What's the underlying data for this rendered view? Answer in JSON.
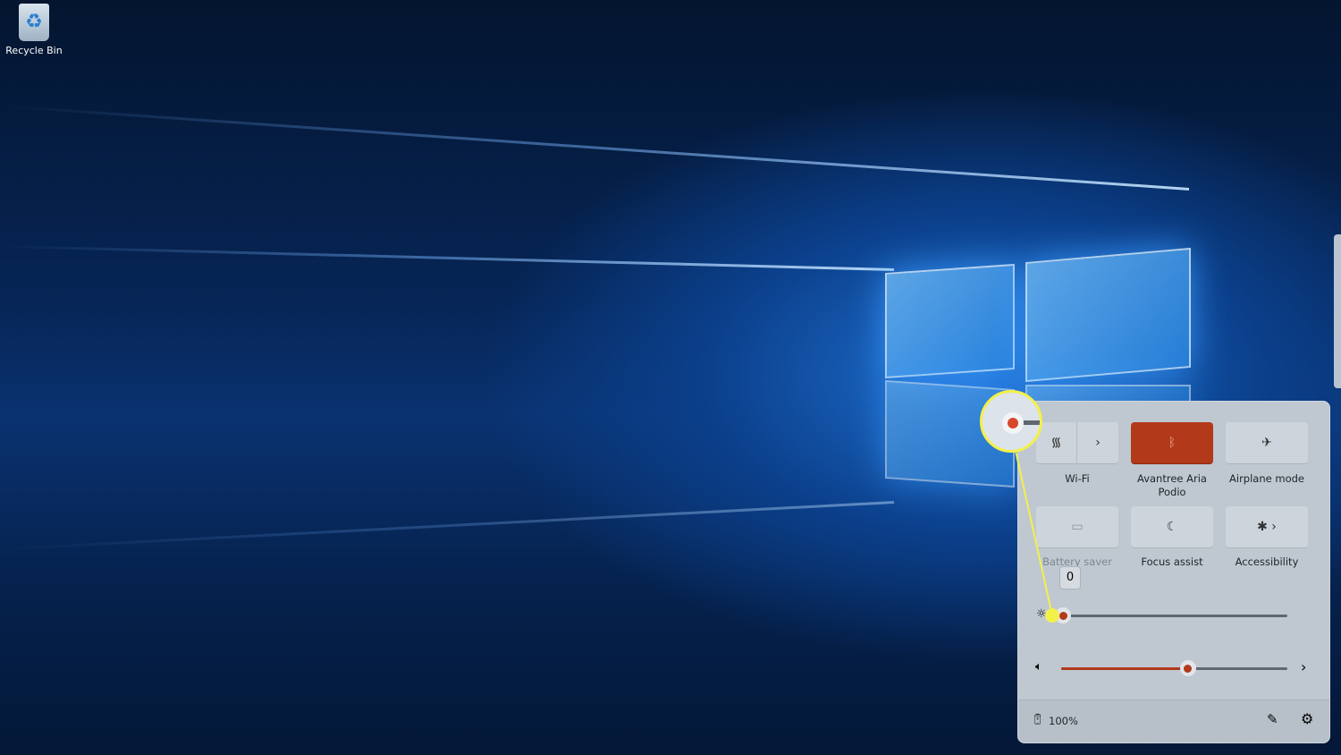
{
  "desktop": {
    "icons": [
      {
        "label": "Recycle Bin",
        "icon": "recycle-bin-icon"
      }
    ]
  },
  "quick_settings": {
    "tiles": [
      {
        "label": "Wi-Fi",
        "icon": "wifi-icon",
        "state": "off",
        "has_chevron": true
      },
      {
        "label": "Avantree Aria Podio",
        "icon": "bluetooth-icon",
        "state": "on"
      },
      {
        "label": "Airplane mode",
        "icon": "airplane-icon",
        "state": "off"
      },
      {
        "label": "Battery saver",
        "icon": "battery-saver-icon",
        "state": "disabled"
      },
      {
        "label": "Focus assist",
        "icon": "moon-icon",
        "state": "off"
      },
      {
        "label": "Accessibility",
        "icon": "accessibility-icon",
        "state": "off",
        "has_chevron": true
      }
    ],
    "brightness": {
      "value": 0,
      "tooltip": "0",
      "icon": "sun-icon"
    },
    "volume": {
      "value": 56,
      "icon": "speaker-icon"
    },
    "battery": {
      "text": "100%",
      "icon": "battery-charging-icon"
    },
    "accent_color": "#b2391a",
    "callout_color": "#f4f04a"
  }
}
